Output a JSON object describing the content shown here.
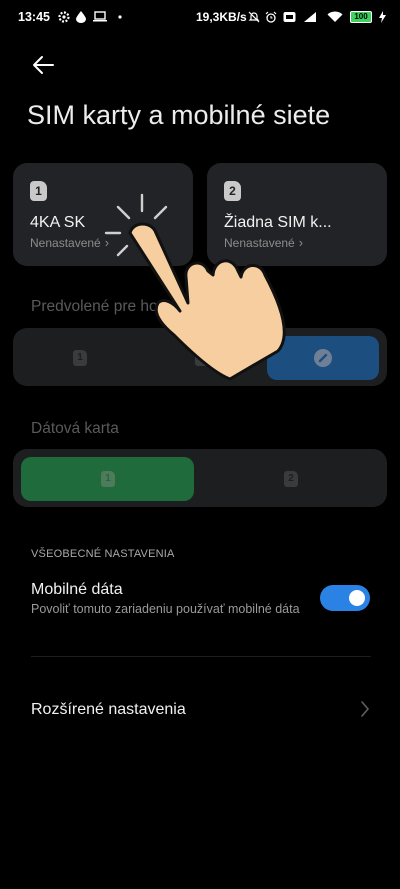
{
  "status_bar": {
    "time": "13:45",
    "net_speed": "19,3KB/s",
    "battery": "100",
    "icons": [
      "gear-icon",
      "drop-icon",
      "laptop-icon",
      "dot-icon",
      "mute-bell-icon",
      "alarm-icon",
      "volte-icon",
      "signal-icon",
      "wifi-icon",
      "battery-icon",
      "charging-icon"
    ]
  },
  "header": {
    "back_icon": "back-arrow-icon",
    "title": "SIM karty a mobilné siete"
  },
  "sim_cards": [
    {
      "slot": "1",
      "name": "4KA SK",
      "status": "Nenastavené",
      "chevron": "›"
    },
    {
      "slot": "2",
      "name": "Žiadna SIM k...",
      "status": "Nenastavené",
      "chevron": "›"
    }
  ],
  "default_calls": {
    "label": "Predvolené pre hov",
    "options": [
      {
        "glyph": "1",
        "icon": "sim1-icon",
        "selected": false
      },
      {
        "glyph": "2",
        "icon": "sim2-icon",
        "selected": false
      },
      {
        "glyph": "",
        "icon": "ask-every-time-icon",
        "selected": true
      }
    ],
    "selected_color": "#1d4e80"
  },
  "data_card": {
    "label": "Dátová karta",
    "options": [
      {
        "glyph": "1",
        "icon": "sim1-icon",
        "selected": true
      },
      {
        "glyph": "2",
        "icon": "sim2-icon",
        "selected": false
      }
    ],
    "selected_color": "#1f6b3c"
  },
  "general": {
    "header": "VŠEOBECNÉ NASTAVENIA",
    "mobile_data": {
      "title": "Mobilné dáta",
      "subtitle": "Povoliť tomuto zariadeniu používať mobilné dáta",
      "enabled": true,
      "toggle_color": "#2a82e4"
    },
    "advanced": {
      "title": "Rozšírené nastavenia",
      "chevron_icon": "chevron-right-icon"
    }
  },
  "overlay": {
    "icon": "tap-hand-icon"
  }
}
